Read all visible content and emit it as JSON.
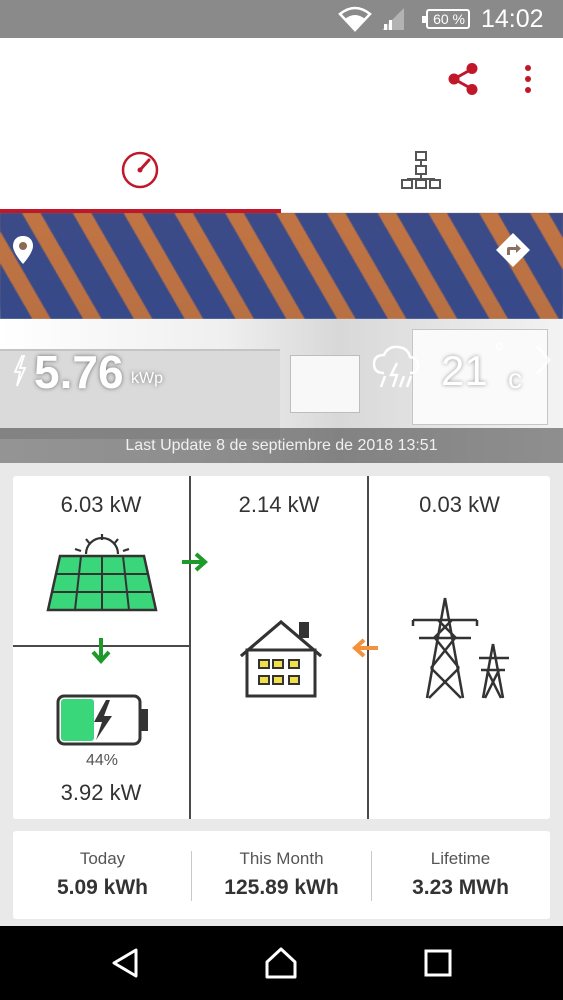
{
  "statusbar": {
    "battery": "60 %",
    "time": "14:02"
  },
  "appbar": {
    "actions": [
      "share-icon",
      "more-vert-icon"
    ]
  },
  "tabs": [
    {
      "icon": "gauge-icon",
      "active": true
    },
    {
      "icon": "hierarchy-icon",
      "active": false
    }
  ],
  "colors": {
    "accent": "#c0182a",
    "solar_green": "#3ad67a",
    "flow_green": "#1e9a2a",
    "flow_orange": "#f3923a"
  },
  "hero": {
    "power_value": "5.76",
    "power_unit": "kWp",
    "temperature": "21",
    "degree_symbol": "°",
    "temperature_unit": "c",
    "weather_icon": "thunderstorm-icon",
    "last_update": "Last Update 8 de septiembre de 2018 13:51"
  },
  "flow": {
    "solar_kw": "6.03 kW",
    "consumption_kw": "2.14 kW",
    "grid_kw": "0.03 kW",
    "battery_percent": "44%",
    "battery_level": 0.44,
    "battery_kw": "3.92 kW"
  },
  "stats": [
    {
      "label": "Today",
      "value": "5.09 kWh"
    },
    {
      "label": "This Month",
      "value": "125.89 kWh"
    },
    {
      "label": "Lifetime",
      "value": "3.23 MWh"
    }
  ]
}
